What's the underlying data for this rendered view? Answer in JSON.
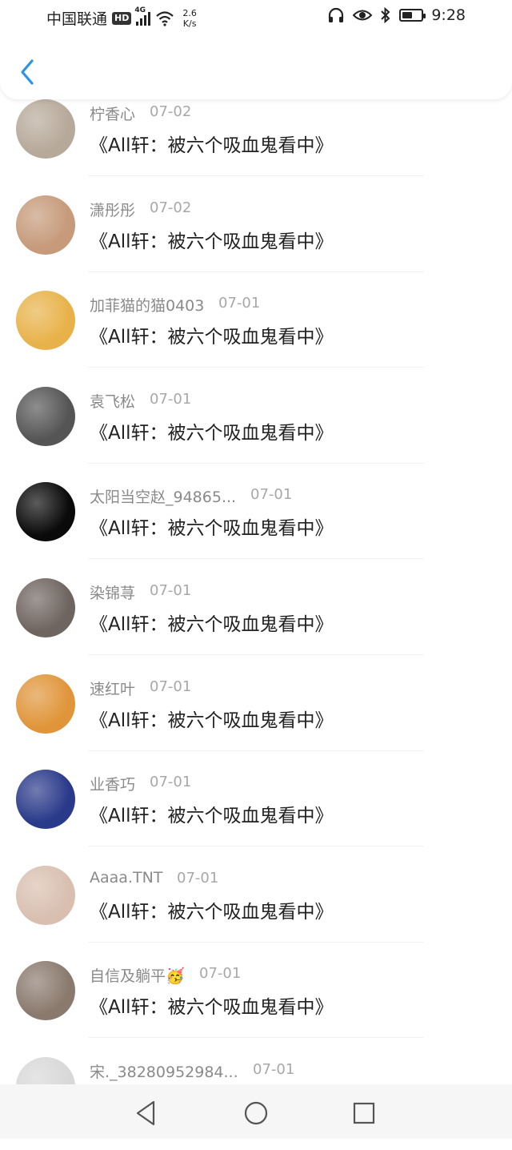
{
  "status_bar": {
    "carrier": "中国联通",
    "hd": "HD",
    "network": "4G",
    "speed_value": "2.6",
    "speed_unit": "K/s",
    "time": "9:28",
    "icons": [
      "headphones-icon",
      "eye-icon",
      "bluetooth-icon",
      "battery-icon"
    ]
  },
  "header": {
    "back_icon": "chevron-left-icon"
  },
  "comments": [
    {
      "user": "柠香心",
      "date": "07-02",
      "title": "《All轩：被六个吸血鬼看中》",
      "avatar_color": "#b7a99a"
    },
    {
      "user": "潇彤彤",
      "date": "07-02",
      "title": "《All轩：被六个吸血鬼看中》",
      "avatar_color": "#c69a7a"
    },
    {
      "user": "加菲猫的猫0403",
      "date": "07-01",
      "title": "《All轩：被六个吸血鬼看中》",
      "avatar_color": "#e8b24a"
    },
    {
      "user": "袁飞松",
      "date": "07-01",
      "title": "《All轩：被六个吸血鬼看中》",
      "avatar_color": "#555555"
    },
    {
      "user": "太阳当空赵_94865...",
      "date": "07-01",
      "title": "《All轩：被六个吸血鬼看中》",
      "avatar_color": "#0a0a0a"
    },
    {
      "user": "染锦荨",
      "date": "07-01",
      "title": "《All轩：被六个吸血鬼看中》",
      "avatar_color": "#6f6560"
    },
    {
      "user": "速红叶",
      "date": "07-01",
      "title": "《All轩：被六个吸血鬼看中》",
      "avatar_color": "#e0953a"
    },
    {
      "user": "业香巧",
      "date": "07-01",
      "title": "《All轩：被六个吸血鬼看中》",
      "avatar_color": "#2a3a8a"
    },
    {
      "user": "Aaaa.TNT",
      "date": "07-01",
      "title": "《All轩：被六个吸血鬼看中》",
      "avatar_color": "#d9bfb0"
    },
    {
      "user": "自信及躺平🥳",
      "date": "07-01",
      "title": "《All轩：被六个吸血鬼看中》",
      "avatar_color": "#8a7a6e"
    },
    {
      "user": "宋._38280952984...",
      "date": "07-01",
      "title": "",
      "avatar_color": "#d8d8d8"
    }
  ],
  "nav_bar": {
    "icons": [
      "back-triangle-icon",
      "home-circle-icon",
      "recents-square-icon"
    ]
  }
}
